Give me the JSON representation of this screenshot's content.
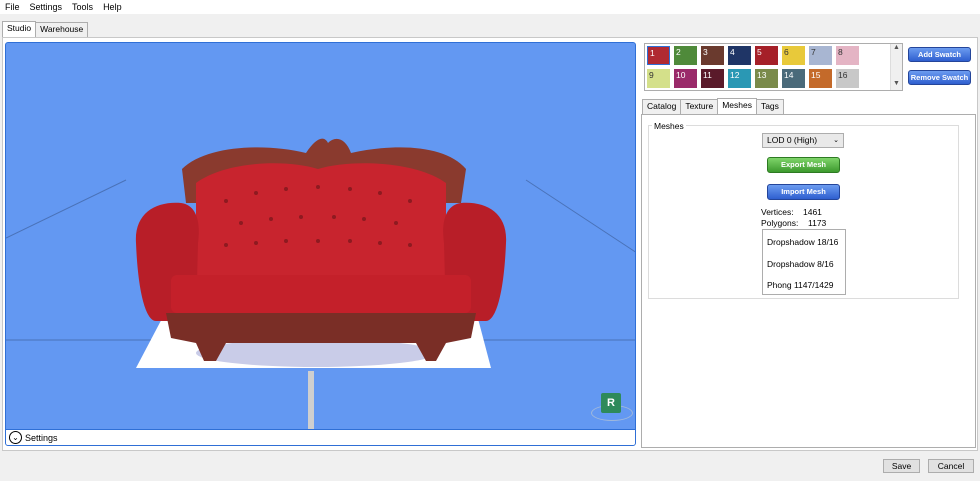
{
  "menu": [
    "File",
    "Settings",
    "Tools",
    "Help"
  ],
  "main_tabs": [
    {
      "label": "Studio"
    },
    {
      "label": "Warehouse"
    }
  ],
  "viewport": {
    "settings_label": "Settings",
    "badge_letter": "R"
  },
  "swatches": [
    {
      "label": "1",
      "color": "#b02a32"
    },
    {
      "label": "2",
      "color": "#4f8a3a"
    },
    {
      "label": "3",
      "color": "#6a3a2e"
    },
    {
      "label": "4",
      "color": "#1f3566"
    },
    {
      "label": "5",
      "color": "#a52028"
    },
    {
      "label": "6",
      "color": "#e8c93a"
    },
    {
      "label": "7",
      "color": "#a8b6d2"
    },
    {
      "label": "8",
      "color": "#e4b4c4"
    },
    {
      "label": "9",
      "color": "#d4e08a"
    },
    {
      "label": "10",
      "color": "#9a2a6a"
    },
    {
      "label": "11",
      "color": "#5a1a2a"
    },
    {
      "label": "12",
      "color": "#2a98b4"
    },
    {
      "label": "13",
      "color": "#7a8a4a"
    },
    {
      "label": "14",
      "color": "#4a6a7a"
    },
    {
      "label": "15",
      "color": "#c46a2a"
    },
    {
      "label": "16",
      "color": "#c8c8c8"
    }
  ],
  "swatch_buttons": {
    "add": "Add Swatch",
    "remove": "Remove Swatch"
  },
  "right_tabs": [
    {
      "label": "Catalog"
    },
    {
      "label": "Texture"
    },
    {
      "label": "Meshes"
    },
    {
      "label": "Tags"
    }
  ],
  "meshes": {
    "group_title": "Meshes",
    "lod_selected": "LOD 0 (High)",
    "export_label": "Export Mesh",
    "import_label": "Import Mesh",
    "vertices_label": "Vertices:",
    "vertices_value": "1461",
    "polygons_label": "Polygons:",
    "polygons_value": "1173",
    "shaders": [
      "Dropshadow 18/16",
      "Dropshadow 8/16",
      "Phong 1147/1429"
    ]
  },
  "footer": {
    "save": "Save",
    "cancel": "Cancel"
  }
}
